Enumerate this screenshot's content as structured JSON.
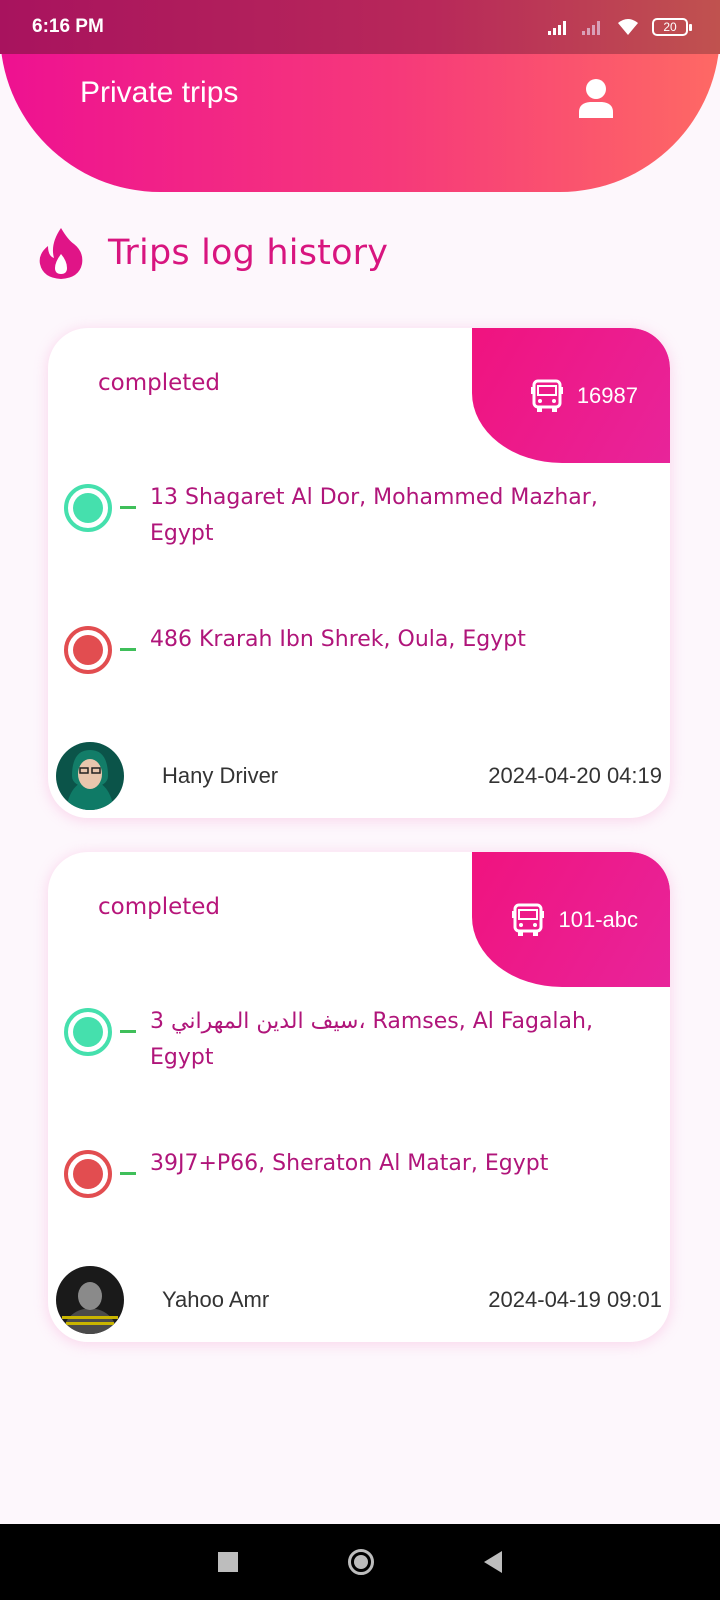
{
  "status_bar": {
    "time": "6:16 PM",
    "battery": "20",
    "icons": [
      "signal-icon",
      "signal-weak-icon",
      "wifi-icon",
      "battery-icon"
    ]
  },
  "header": {
    "title": "Private trips",
    "profile_icon": "person-icon"
  },
  "section": {
    "icon": "fire-icon",
    "title": "Trips log history"
  },
  "trips": [
    {
      "status": "completed",
      "bus_number": "16987",
      "pickup": "13 Shagaret Al Dor, Mohammed Mazhar, Egypt",
      "dropoff": "486 Krarah Ibn Shrek, Oula, Egypt",
      "driver": "Hany Driver",
      "date": "2024-04-20 04:19"
    },
    {
      "status": "completed",
      "bus_number": "101-abc",
      "pickup": "3 سيف الدين المهراني، Ramses, Al Fagalah, Egypt",
      "dropoff": "39J7+P66, Sheraton Al Matar, Egypt",
      "driver": "Yahoo Amr",
      "date": "2024-04-19 09:01"
    }
  ],
  "colors": {
    "accent": "#d8157f",
    "header_start": "#ee1191",
    "header_end": "#fe6964",
    "pickup": "#45e0ad",
    "dropoff": "#e24d50"
  }
}
